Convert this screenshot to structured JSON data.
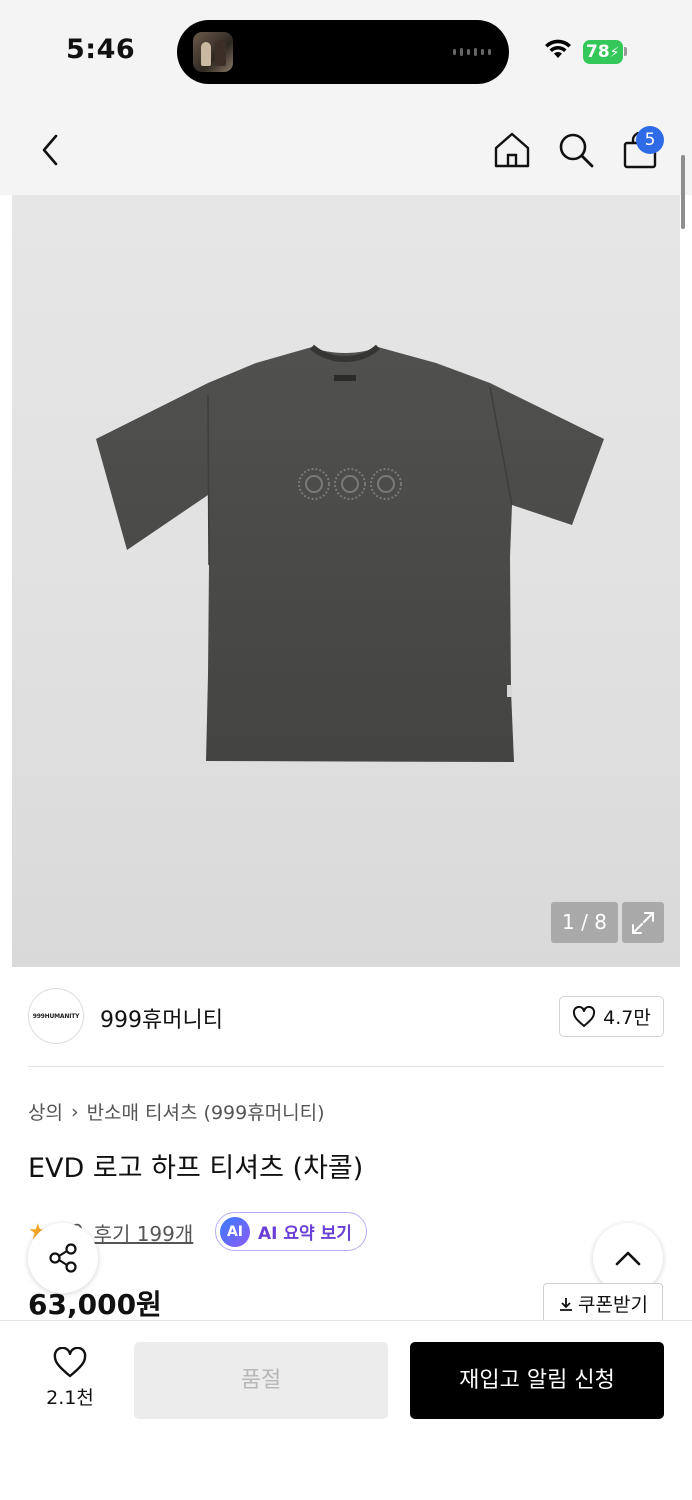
{
  "status_bar": {
    "time": "5:46",
    "battery": "78"
  },
  "nav": {
    "cart_count": "5"
  },
  "gallery": {
    "page_counter": "1 / 8",
    "print_text": "999"
  },
  "brand": {
    "logo_text": "999HUMANITY",
    "name": "999휴머니티",
    "likes": "4.7만"
  },
  "breadcrumb": {
    "category": "상의",
    "separator": "›",
    "subcategory": "반소매 티셔츠 (999휴머니티)"
  },
  "product": {
    "title": "EVD 로고 하프 티셔츠 (차콜)",
    "rating": "4.9",
    "review_link": "후기 199개",
    "ai_badge": "AI",
    "ai_label": "AI 요약 보기",
    "price": "63,000원",
    "coupon": "쿠폰받기"
  },
  "bottom_bar": {
    "wish_count": "2.1천",
    "soldout_label": "품절",
    "restock_label": "재입고 알림 신청"
  },
  "colors": {
    "accent_blue": "#2f6be6",
    "ai_purple": "#6a3fd6",
    "battery_green": "#34c759",
    "shirt": "#4a4a48"
  }
}
